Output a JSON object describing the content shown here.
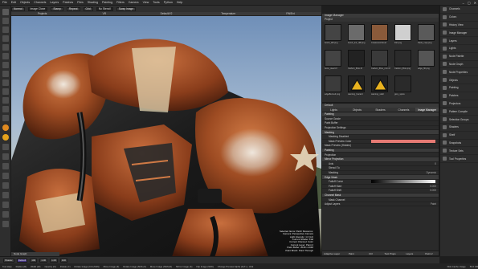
{
  "menubar": {
    "items": [
      "File",
      "Edit",
      "Objects",
      "Channels",
      "Layers",
      "Patches",
      "Files",
      "Shading",
      "Painting",
      "Filters",
      "Camera",
      "View",
      "Tools",
      "Python",
      "Help"
    ],
    "window_controls": [
      "–",
      "▢",
      "✕"
    ]
  },
  "toolbar": {
    "items": [
      {
        "name": "brush-type",
        "label": "Normal"
      },
      {
        "name": "image-clone",
        "label": "Image Clone"
      },
      {
        "name": "tab-1",
        "label": "Stamp"
      },
      {
        "name": "tab-2",
        "label": "Repeat"
      },
      {
        "name": "tab-3",
        "label": "Grid"
      },
      {
        "name": "no-stencil",
        "label": "No Stencil"
      },
      {
        "name": "swap",
        "label": "Swap Image"
      }
    ]
  },
  "layer_header": [
    "Projects",
    "VR",
    "Default/V2",
    "Temperature",
    "FW/Ext"
  ],
  "viewport_overlay": [
    "Selected Items: Patch Resource:",
    "Camera: Perspective Camera",
    "Light Intensity: 1.0 (Lit)",
    "Current Shader: Flat",
    "Current Channel: Color",
    "Current Layer: Paint 2",
    "Paint Buffer: 2048 x 2048",
    "Paint Brush: Paint Through"
  ],
  "image_manager": {
    "title": "Image Manager",
    "tabs": [
      "Project"
    ],
    "thumbs": [
      {
        "label": "bomb_diff.png",
        "color": "#444"
      },
      {
        "label": "bomb_intr_diff.png",
        "color": "#6b6b6b"
      },
      {
        "label": "Creatures/Cloud",
        "color": "#8a5a3a"
      },
      {
        "label": "Dirt.png",
        "color": "#cfcfcf"
      },
      {
        "label": "Pads_map.png",
        "color": "#5a5a5a"
      },
      {
        "label": "bonn_steel.tif",
        "color": "#444"
      },
      {
        "label": "Carbon_fibre.tif",
        "color": "#222"
      },
      {
        "label": "Carbon_fibre_nrm.tif",
        "color": "#3a3a3a"
      },
      {
        "label": "Carbon_fibre.png",
        "color": "#2b2b2b"
      },
      {
        "label": "edge_fill.png",
        "color": "#555"
      },
      {
        "label": "edgeBurned.png",
        "color": "#3b3b3b"
      },
      {
        "label": "warning_hazard",
        "color": "#d9a21a"
      },
      {
        "label": "warning_skull",
        "color": "#d9a21a"
      },
      {
        "label": "grey_spots",
        "color": "#2a2a2a"
      }
    ]
  },
  "properties": {
    "tabs": [
      "Lights",
      "Objects",
      "Shaders",
      "Channels",
      "Image Manager"
    ],
    "active_tab": "Image Manager",
    "rows": [
      {
        "label": "Painting",
        "kind": "hdr",
        "value": ""
      },
      {
        "label": "Source Grade",
        "kind": "row",
        "value": ""
      },
      {
        "label": "Paint Buffer",
        "kind": "row",
        "value": ""
      },
      {
        "label": "Projection Settings",
        "kind": "row",
        "value": ""
      },
      {
        "label": "Masking",
        "kind": "hdr",
        "value": ""
      },
      {
        "label": "Masking Disabled",
        "kind": "sub",
        "value": ""
      },
      {
        "label": "Mask Preview Color",
        "kind": "sub",
        "value": ""
      },
      {
        "label": "Mask Preview (Hidden)",
        "kind": "row",
        "value": ""
      },
      {
        "label": "Painting",
        "kind": "hdr",
        "value": ""
      },
      {
        "label": "Projection",
        "kind": "row",
        "value": ""
      },
      {
        "label": "Mirror Projection",
        "kind": "hdr",
        "value": ""
      },
      {
        "label": "Axis",
        "kind": "sub",
        "value": "X"
      },
      {
        "label": "Stencil To",
        "kind": "sub",
        "value": ""
      },
      {
        "label": "Masking",
        "kind": "sub",
        "value": "Dynamic"
      },
      {
        "label": "Edge Mask",
        "kind": "hdr",
        "value": ""
      },
      {
        "label": "Falloff Curve",
        "kind": "sub",
        "value": ""
      },
      {
        "label": "Falloff Start",
        "kind": "sub",
        "value": "0.000"
      },
      {
        "label": "Falloff Shift",
        "kind": "sub",
        "value": "0.000"
      },
      {
        "label": "Channel Mask",
        "kind": "hdr",
        "value": ""
      },
      {
        "label": "Mask Channel",
        "kind": "sub",
        "value": ""
      },
      {
        "label": "Adjust Layers",
        "kind": "row",
        "value": "Paint"
      }
    ],
    "bottom_tabs": [
      "Adaptive Layer",
      "Paint",
      "Ctrl",
      "Tool Props",
      "Layers",
      "Paint 2"
    ],
    "mask_color": "#e77a74"
  },
  "palettes": [
    "Channels",
    "Colors",
    "History View",
    "Image Manager",
    "Layers",
    "Lights",
    "Node Palette",
    "Node Graph",
    "Node Properties",
    "Objects",
    "Painting",
    "Patches",
    "Projectors",
    "Pattern Compile",
    "Selection Groups",
    "Shaders",
    "Shelf",
    "Snapshots",
    "Texture Sets",
    "Tool Properties"
  ],
  "node_graph_label": "Node Graph",
  "bottom_tools": [
    "Shader",
    "Default",
    "100",
    "1.00",
    "1.00",
    "100"
  ],
  "statusbar": [
    "Tool Help",
    "Radius (R)",
    "Width (W)",
    "Opacity (O)",
    "Rotate (Y)",
    "Rotate Image (Ctrl+Shift)",
    "Move Image (Z)",
    "Rotate Image (Shift+X)",
    "Move Image (Shift+D)",
    "Mirror Image (X)",
    "Flip Image (Shift)",
    "Change Preview Alpha (ALT) + click",
    "Disk Cache Usage",
    "50.0 GB"
  ]
}
